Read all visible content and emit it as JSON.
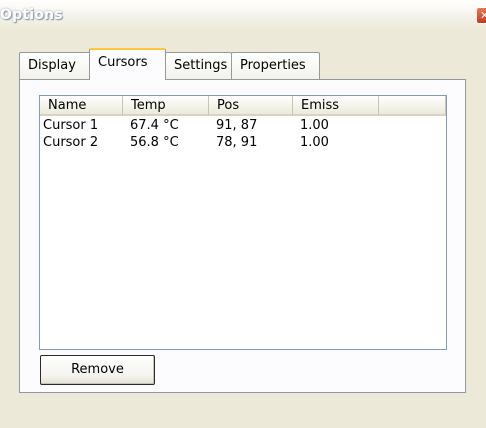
{
  "window": {
    "title": "Options",
    "close_glyph": "✕",
    "accent_color": "#ffc83c"
  },
  "tabs": [
    {
      "label": "Display",
      "active": false
    },
    {
      "label": "Cursors",
      "active": true
    },
    {
      "label": "Settings",
      "active": false
    },
    {
      "label": "Properties",
      "active": false
    }
  ],
  "list": {
    "columns": [
      "Name",
      "Temp",
      "Pos",
      "Emiss",
      ""
    ],
    "rows": [
      {
        "name": "Cursor 1",
        "temp": "67.4 °C",
        "pos": "91, 87",
        "emiss": "1.00"
      },
      {
        "name": "Cursor 2",
        "temp": "56.8 °C",
        "pos": "78, 91",
        "emiss": "1.00"
      }
    ]
  },
  "buttons": {
    "remove_label": "Remove"
  }
}
